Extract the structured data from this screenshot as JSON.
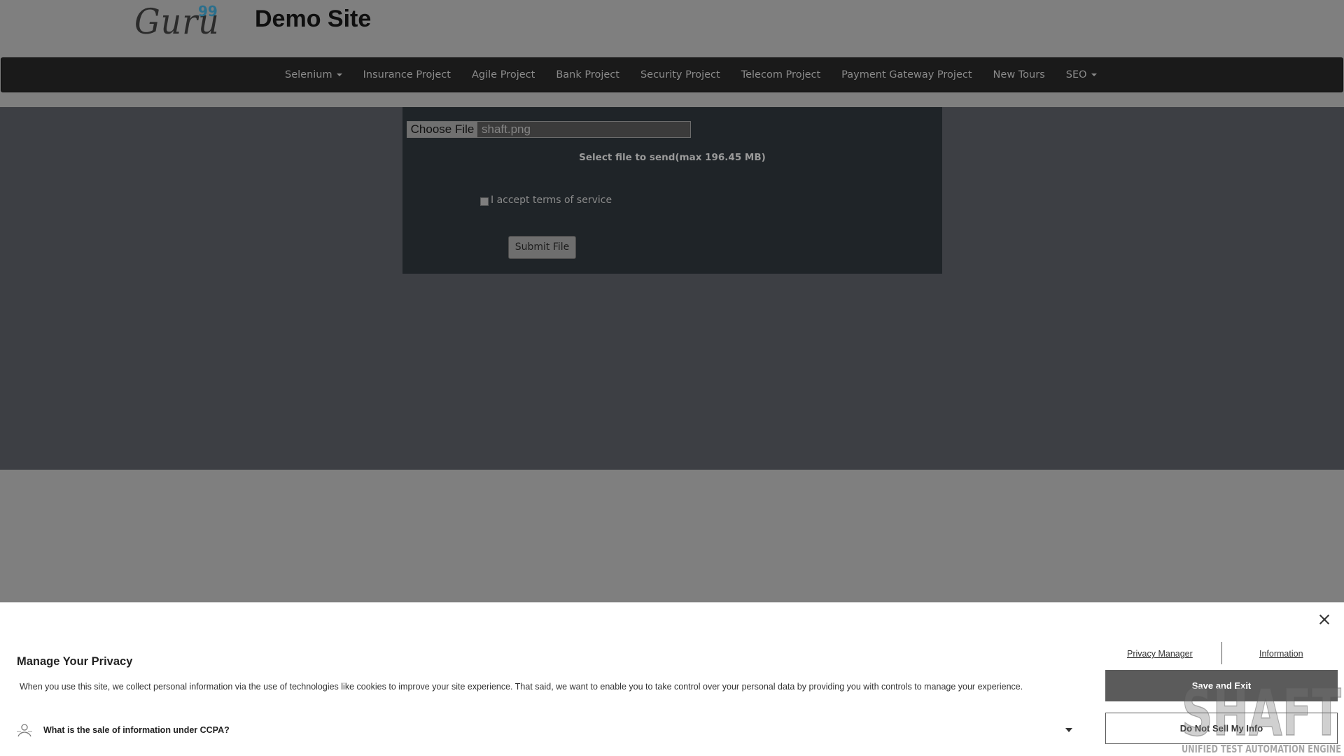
{
  "header": {
    "logo_text": "Guru",
    "logo_sup": "99",
    "site_title": "Demo Site"
  },
  "nav": {
    "items": [
      {
        "label": "Selenium",
        "dropdown": true
      },
      {
        "label": "Insurance Project",
        "dropdown": false
      },
      {
        "label": "Agile Project",
        "dropdown": false
      },
      {
        "label": "Bank Project",
        "dropdown": false
      },
      {
        "label": "Security Project",
        "dropdown": false
      },
      {
        "label": "Telecom Project",
        "dropdown": false
      },
      {
        "label": "Payment Gateway Project",
        "dropdown": false
      },
      {
        "label": "New Tours",
        "dropdown": false
      },
      {
        "label": "SEO",
        "dropdown": true
      }
    ]
  },
  "upload_form": {
    "choose_file_label": "Choose File",
    "file_name": "shaft.png",
    "hint": "Select file to send(max 196.45 MB)",
    "terms_label": "I accept terms of service",
    "terms_checked": false,
    "submit_label": "Submit File"
  },
  "privacy": {
    "title": "Manage Your Privacy",
    "text": "When you use this site, we collect personal information via the use of technologies like cookies to improve your site experience. That said, we want to enable you to take control over your personal data by providing you with controls to manage your experience.",
    "ccpa_question": "What is the sale of information under CCPA?",
    "privacy_manager_link": "Privacy Manager",
    "information_link": "Information",
    "save_exit_label": "Save and Exit",
    "do_not_sell_label": "Do Not Sell My Info"
  },
  "watermark": {
    "brand": "SHAFT",
    "tagline": "UNIFIED TEST AUTOMATION ENGINE"
  },
  "icons": {
    "close": "close-icon",
    "ccpa": "ccpa-info-icon",
    "dropdown": "chevron-down-icon"
  }
}
